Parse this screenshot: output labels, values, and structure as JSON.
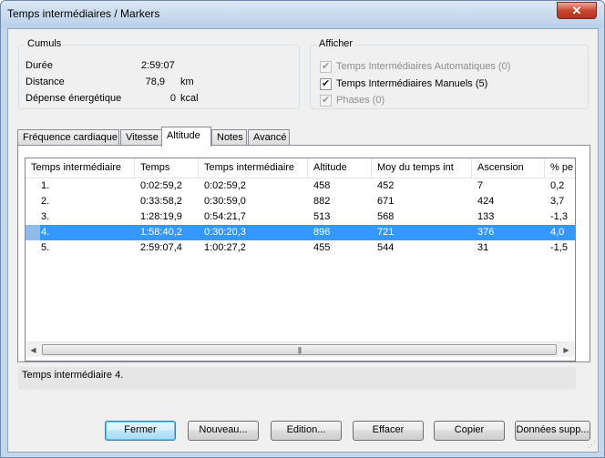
{
  "window": {
    "title": "Temps intermédiaires / Markers"
  },
  "cumuls": {
    "title": "Cumuls",
    "duree_label": "Durée",
    "duree_value": "2:59:07",
    "distance_label": "Distance",
    "distance_value": "78,9",
    "distance_unit": "km",
    "energie_label": "Dépense énergétique",
    "energie_value": "0",
    "energie_unit": "kcal"
  },
  "afficher": {
    "title": "Afficher",
    "options": [
      {
        "label": "Temps Intermédiaires Automatiques (0)",
        "checked": true,
        "enabled": false
      },
      {
        "label": "Temps Intermédiaires Manuels (5)",
        "checked": true,
        "enabled": true
      },
      {
        "label": "Phases (0)",
        "checked": true,
        "enabled": false
      }
    ]
  },
  "tabs": [
    {
      "label": "Fréquence cardiaque",
      "active": false
    },
    {
      "label": "Vitesse",
      "active": false
    },
    {
      "label": "Altitude",
      "active": true
    },
    {
      "label": "Notes",
      "active": false
    },
    {
      "label": "Avancé",
      "active": false
    }
  ],
  "table": {
    "columns": [
      "Temps intermédiaire",
      "Temps",
      "Temps intermédiaire",
      "Altitude",
      "Moy du temps int",
      "Ascension",
      "% pe"
    ],
    "rows": [
      [
        "1.",
        "0:02:59,2",
        "0:02:59,2",
        "458",
        "452",
        "7",
        "0,2"
      ],
      [
        "2.",
        "0:33:58,2",
        "0:30:59,0",
        "882",
        "671",
        "424",
        "3,7"
      ],
      [
        "3.",
        "1:28:19,9",
        "0:54:21,7",
        "513",
        "568",
        "133",
        "-1,3"
      ],
      [
        "4.",
        "1:58:40,2",
        "0:30:20,3",
        "896",
        "721",
        "376",
        "4,0"
      ],
      [
        "5.",
        "2:59:07,4",
        "1:00:27,2",
        "455",
        "544",
        "31",
        "-1,5"
      ]
    ],
    "selected_row": 3
  },
  "status_text": "Temps intermédiaire 4.",
  "buttons": {
    "fermer": "Fermer",
    "nouveau": "Nouveau...",
    "edition": "Edition...",
    "effacer": "Effacer",
    "copier": "Copier",
    "donnees": "Données supp..."
  },
  "icons": {
    "close": "close-icon",
    "scroll_left": "scroll-left-arrow-icon",
    "scroll_right": "scroll-right-arrow-icon",
    "check": "checkmark-icon"
  }
}
